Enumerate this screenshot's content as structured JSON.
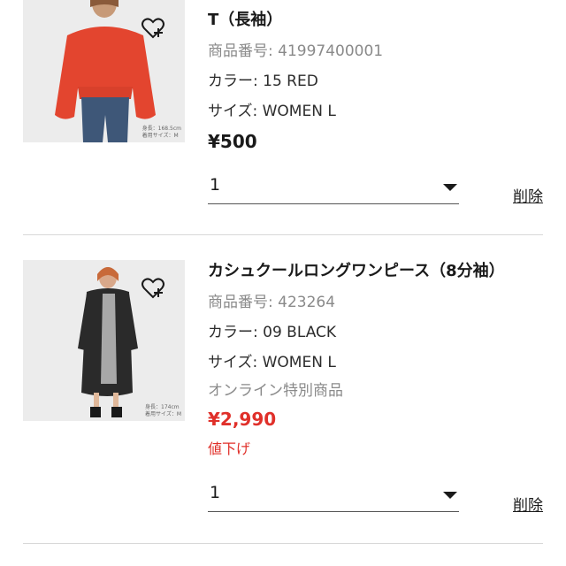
{
  "items": [
    {
      "name_partial": "T（長袖）",
      "product_number": "商品番号: 41997400001",
      "color": "カラー: 15 RED",
      "size": "サイズ: WOMEN L",
      "price": "¥500",
      "quantity": "1",
      "remove_label": "削除",
      "photo_caption_line1": "身長：168.5cm",
      "photo_caption_line2": "着用サイズ：M"
    },
    {
      "name": "カシュクールロングワンピース（8分袖）",
      "product_number": "商品番号: 423264",
      "color": "カラー: 09 BLACK",
      "size": "サイズ: WOMEN L",
      "online_exclusive": "オンライン特別商品",
      "price": "¥2,990",
      "reduced_label": "値下げ",
      "quantity": "1",
      "remove_label": "削除",
      "photo_caption_line1": "身長：174cm",
      "photo_caption_line2": "着用サイズ：M"
    }
  ],
  "colors": {
    "sale_red": "#e0302a",
    "divider": "#d8d8d8"
  },
  "icons": {
    "favorite": "heart-plus-icon",
    "dropdown": "caret-down-icon"
  }
}
